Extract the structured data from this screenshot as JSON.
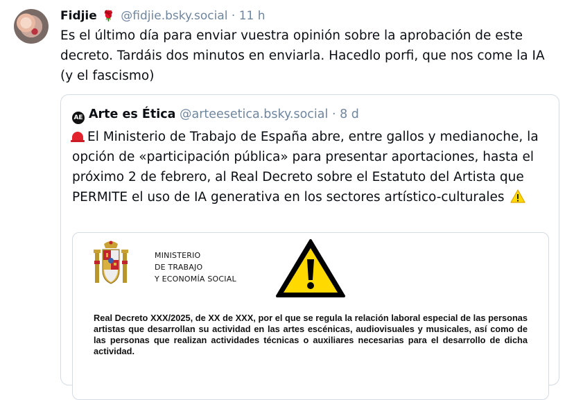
{
  "post": {
    "author_name": "Fidjie",
    "author_emoji": "🌹",
    "handle": "@fidjie.bsky.social",
    "separator": "·",
    "time": "11 h",
    "text": "Es el último día para enviar vuestra opinión sobre la aprobación de este decreto. Tardáis dos minutos en enviarla. Hacedlo porfi, que nos come la IA (y el fascismo)"
  },
  "quote": {
    "avatar_text": "AE",
    "author_name": "Arte es Ética",
    "handle": "@arteesetica.bsky.social",
    "separator": "·",
    "time": "8 d",
    "text": "El Ministerio de Trabajo de España abre, entre gallos y medianoche, la opción de «participación pública» para presentar aportaciones, hasta el próximo 2 de febrero, al Real Decreto sobre el Estatuto del Artista que PERMITE el uso de IA generativa en los sectores artístico-culturales",
    "image": {
      "ministry_lines": [
        "MINISTERIO",
        "DE TRABAJO",
        "Y ECONOMÍA SOCIAL"
      ],
      "decree_text": "Real Decreto XXX/2025, de XX de XXX, por el que se regula la relación laboral especial de las personas artistas que desarrollan su actividad en las artes escénicas, audiovisuales y musicales, así como de las personas que realizan actividades técnicas o auxiliares necesarias para el desarrollo de dicha actividad."
    }
  },
  "colors": {
    "handle_gray": "#6f869f",
    "border": "#d4dbe2",
    "warning_yellow": "#ffd900",
    "siren_red": "#e2232e"
  },
  "icons": [
    "avatar",
    "rose-emoji-icon",
    "siren-emoji-icon",
    "warning-emoji-icon",
    "coat-of-arms-icon",
    "warning-sign-icon"
  ]
}
